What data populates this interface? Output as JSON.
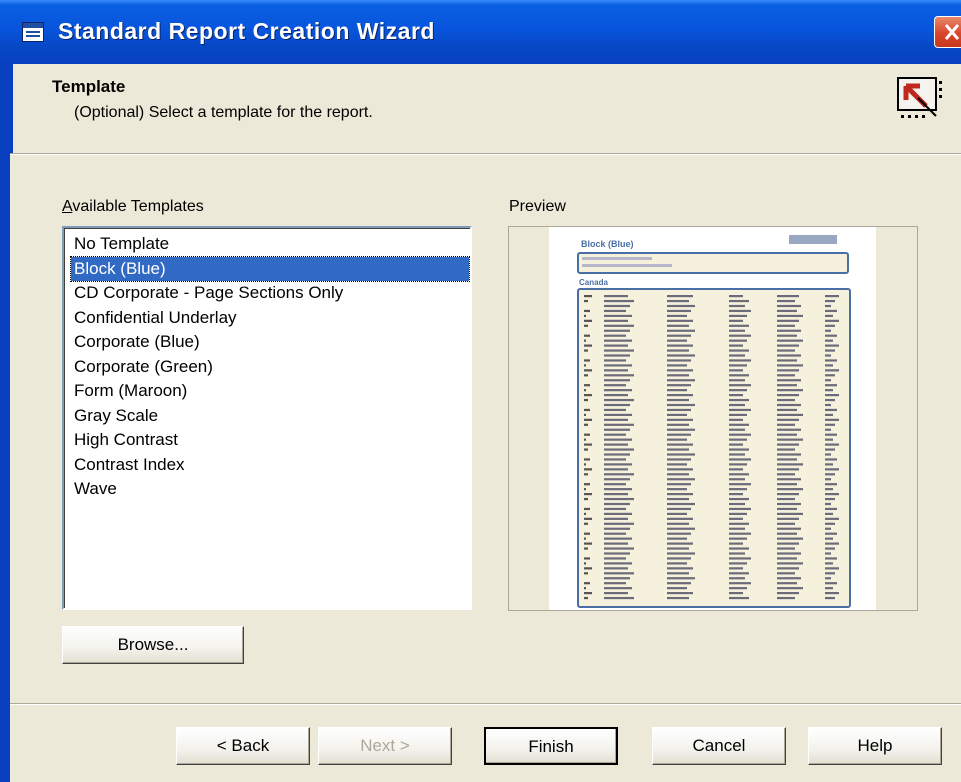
{
  "window": {
    "title": "Standard Report Creation Wizard"
  },
  "header": {
    "title": "Template",
    "subtitle": "(Optional) Select a template for the report."
  },
  "available": {
    "label_prefix": "",
    "label_mnemonic": "A",
    "label_rest": "vailable Templates",
    "items": [
      "No Template",
      "Block (Blue)",
      "CD Corporate - Page Sections Only",
      "Confidential Underlay",
      "Corporate (Blue)",
      "Corporate (Green)",
      "Form (Maroon)",
      "Gray Scale",
      "High Contrast",
      "Contrast Index",
      "Wave"
    ],
    "selected": "Block (Blue)"
  },
  "preview": {
    "label": "Preview",
    "page_title": "Block (Blue)",
    "group_label": "Canada"
  },
  "buttons": {
    "browse": "Browse...",
    "back": "< Back",
    "next": "Next >",
    "finish": "Finish",
    "cancel": "Cancel",
    "help": "Help"
  },
  "colors": {
    "titlebar": "#0A5FE0",
    "selection": "#316AC5",
    "dialog_bg": "#ECE9D8"
  }
}
